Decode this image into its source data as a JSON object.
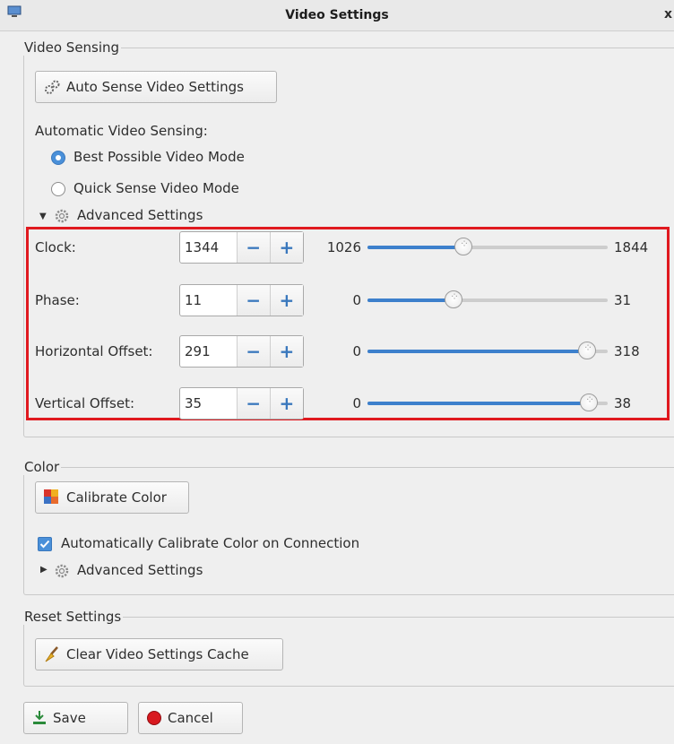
{
  "window": {
    "title": "Video Settings",
    "close": "x"
  },
  "video_sensing": {
    "legend": "Video Sensing",
    "auto_sense_button": "Auto Sense Video Settings",
    "auto_label": "Automatic Video Sensing:",
    "radio_best": {
      "label": "Best Possible Video Mode",
      "selected": true
    },
    "radio_quick": {
      "label": "Quick Sense Video Mode",
      "selected": false
    },
    "advanced_label": "Advanced Settings",
    "advanced_expanded": true
  },
  "advanced": {
    "rows": [
      {
        "label": "Clock:",
        "value": "1344",
        "min": "1026",
        "max": "1844",
        "fraction": 0.4
      },
      {
        "label": "Phase:",
        "value": "11",
        "min": "0",
        "max": "31",
        "fraction": 0.36
      },
      {
        "label": "Horizontal Offset:",
        "value": "291",
        "min": "0",
        "max": "318",
        "fraction": 0.915
      },
      {
        "label": "Vertical Offset:",
        "value": "35",
        "min": "0",
        "max": "38",
        "fraction": 0.92
      }
    ],
    "minus": "−",
    "plus": "+"
  },
  "color": {
    "legend": "Color",
    "calibrate_button": "Calibrate Color",
    "auto_calibrate_label": "Automatically Calibrate Color on Connection",
    "auto_calibrate_checked": true,
    "advanced_label": "Advanced Settings",
    "advanced_expanded": false
  },
  "reset": {
    "legend": "Reset Settings",
    "clear_button": "Clear Video Settings Cache"
  },
  "footer": {
    "save_button": "Save",
    "cancel_button": "Cancel"
  },
  "colors": {
    "accent": "#4a90d9",
    "highlight": "#e0191f",
    "slider_fill": "#3d80cc"
  }
}
